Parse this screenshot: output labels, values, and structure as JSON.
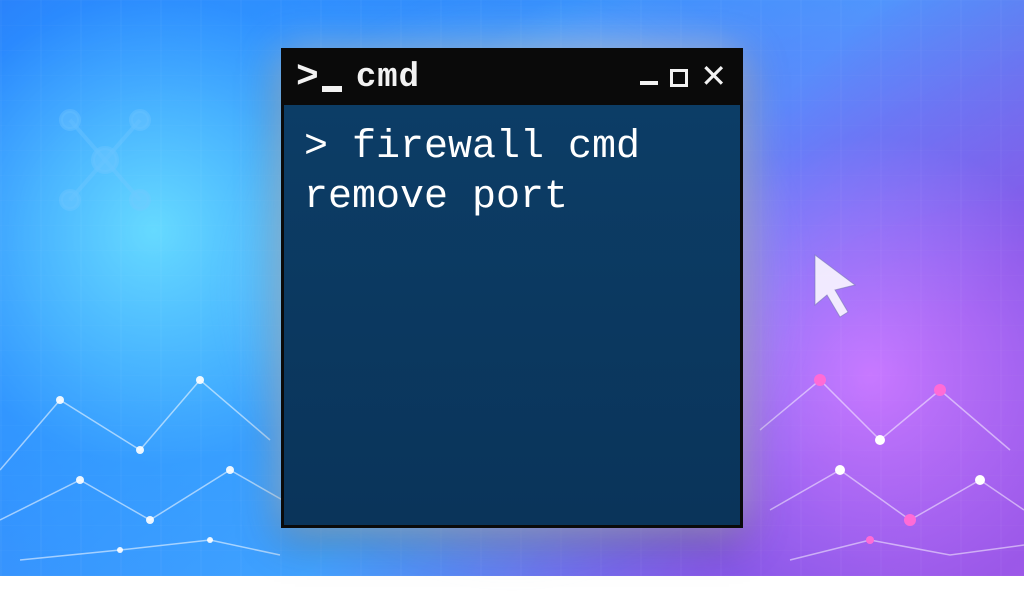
{
  "window": {
    "title": "cmd",
    "prompt_glyph": ">_"
  },
  "terminal": {
    "prompt": "> ",
    "command": "firewall cmd remove port"
  },
  "colors": {
    "titlebar_bg": "#0a0a0a",
    "terminal_bg": "#0a3a63",
    "text": "#ffffff"
  }
}
